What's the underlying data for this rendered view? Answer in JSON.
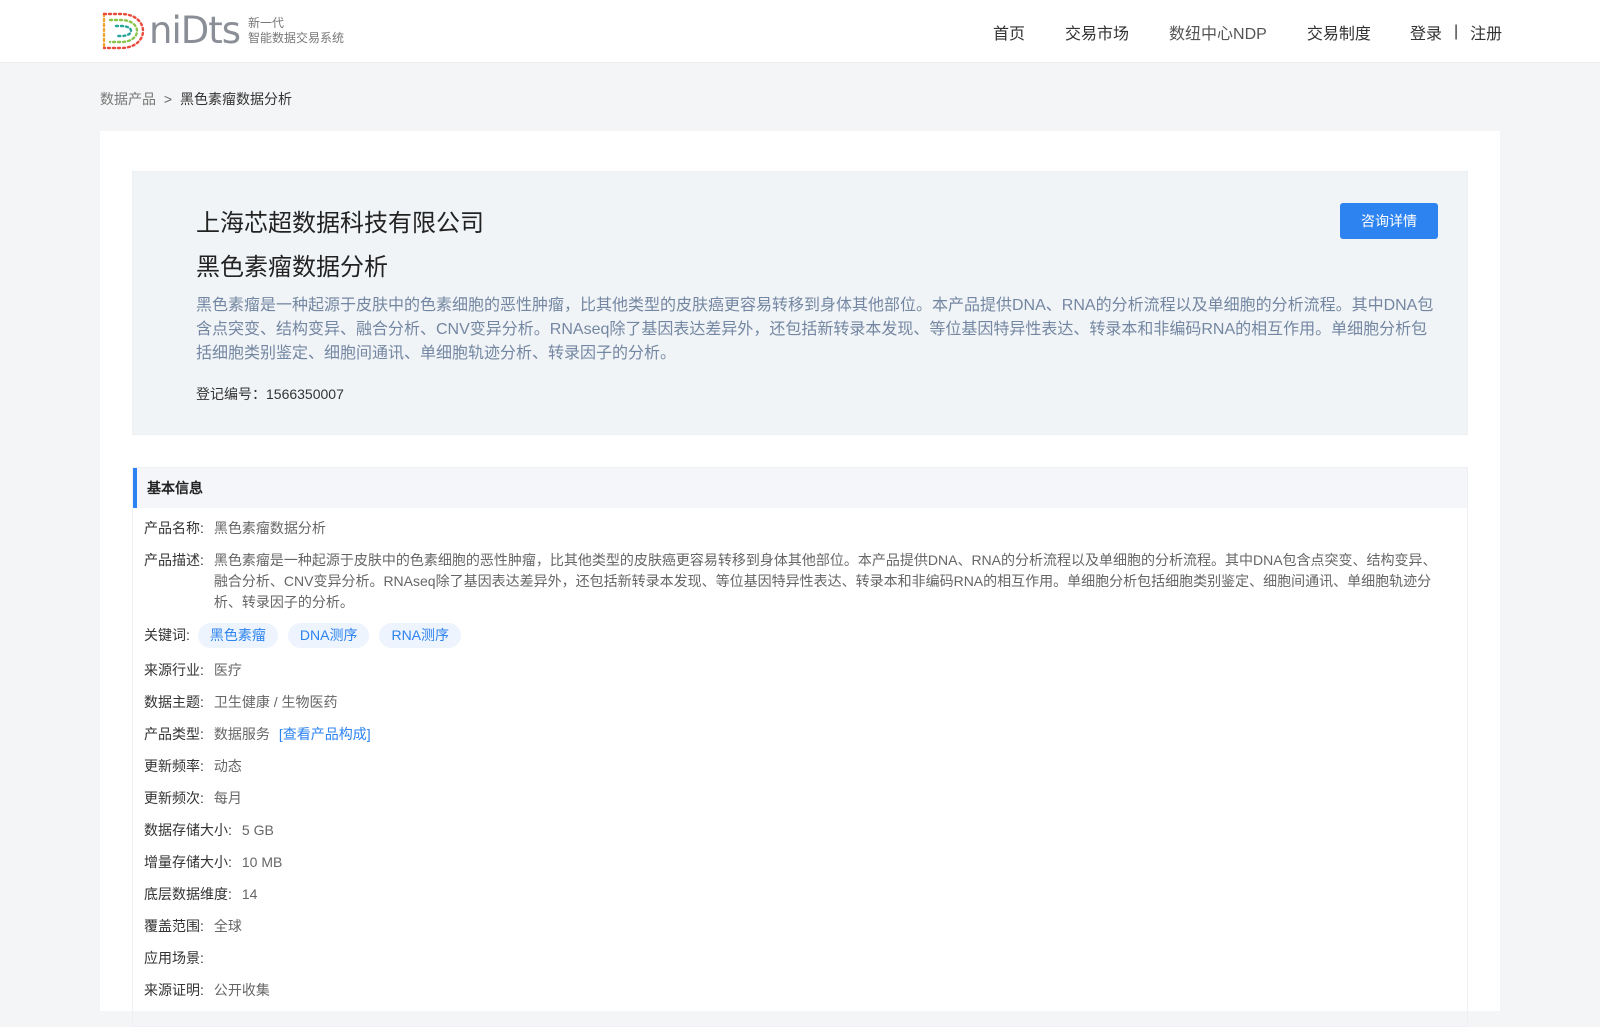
{
  "logo": {
    "word": "niDts",
    "tagline_1": "新一代",
    "tagline_2": "智能数据交易系统"
  },
  "nav": {
    "home": "首页",
    "market": "交易市场",
    "ndp": "数纽中心NDP",
    "rules": "交易制度"
  },
  "auth": {
    "login": "登录",
    "separator": "|",
    "register": "注册"
  },
  "breadcrumb": {
    "parent": "数据产品",
    "separator": ">",
    "current": "黑色素瘤数据分析"
  },
  "hero": {
    "company": "上海芯超数据科技有限公司",
    "product": "黑色素瘤数据分析",
    "description": "黑色素瘤是一种起源于皮肤中的色素细胞的恶性肿瘤，比其他类型的皮肤癌更容易转移到身体其他部位。本产品提供DNA、RNA的分析流程以及单细胞的分析流程。其中DNA包含点突变、结构变异、融合分析、CNV变异分析。RNAseq除了基因表达差异外，还包括新转录本发现、等位基因特异性表达、转录本和非编码RNA的相互作用。单细胞分析包括细胞类别鉴定、细胞间通讯、单细胞轨迹分析、转录因子的分析。",
    "registration": "登记编号：1566350007",
    "consult_button": "咨询详情"
  },
  "basic_info": {
    "title": "基本信息",
    "name_label": "产品名称:",
    "name_value": "黑色素瘤数据分析",
    "desc_label": "产品描述:",
    "desc_value": "黑色素瘤是一种起源于皮肤中的色素细胞的恶性肿瘤，比其他类型的皮肤癌更容易转移到身体其他部位。本产品提供DNA、RNA的分析流程以及单细胞的分析流程。其中DNA包含点突变、结构变异、融合分析、CNV变异分析。RNAseq除了基因表达差异外，还包括新转录本发现、等位基因特异性表达、转录本和非编码RNA的相互作用。单细胞分析包括细胞类别鉴定、细胞间通讯、单细胞轨迹分析、转录因子的分析。",
    "keywords_label": "关键词:",
    "keywords": [
      "黑色素瘤",
      "DNA测序",
      "RNA测序"
    ],
    "industry_label": "来源行业:",
    "industry_value": "医疗",
    "theme_label": "数据主题:",
    "theme_value": "卫生健康 / 生物医药",
    "type_label": "产品类型:",
    "type_value": "数据服务",
    "type_link": "[查看产品构成]",
    "frequency_label": "更新频率:",
    "frequency_value": "动态",
    "cadence_label": "更新频次:",
    "cadence_value": "每月",
    "storage_label": "数据存储大小:",
    "storage_value": "5 GB",
    "increment_label": "增量存储大小:",
    "increment_value": "10 MB",
    "dimension_label": "底层数据维度:",
    "dimension_value": "14",
    "coverage_label": "覆盖范围:",
    "coverage_value": "全球",
    "scenario_label": "应用场景:",
    "scenario_value": "",
    "proof_label": "来源证明:",
    "proof_value": "公开收集"
  },
  "colors": {
    "accent": "#2d83f0",
    "tag_bg": "#edf4fd",
    "hero_bg": "#f1f4f7",
    "page_bg": "#f4f5f6"
  }
}
